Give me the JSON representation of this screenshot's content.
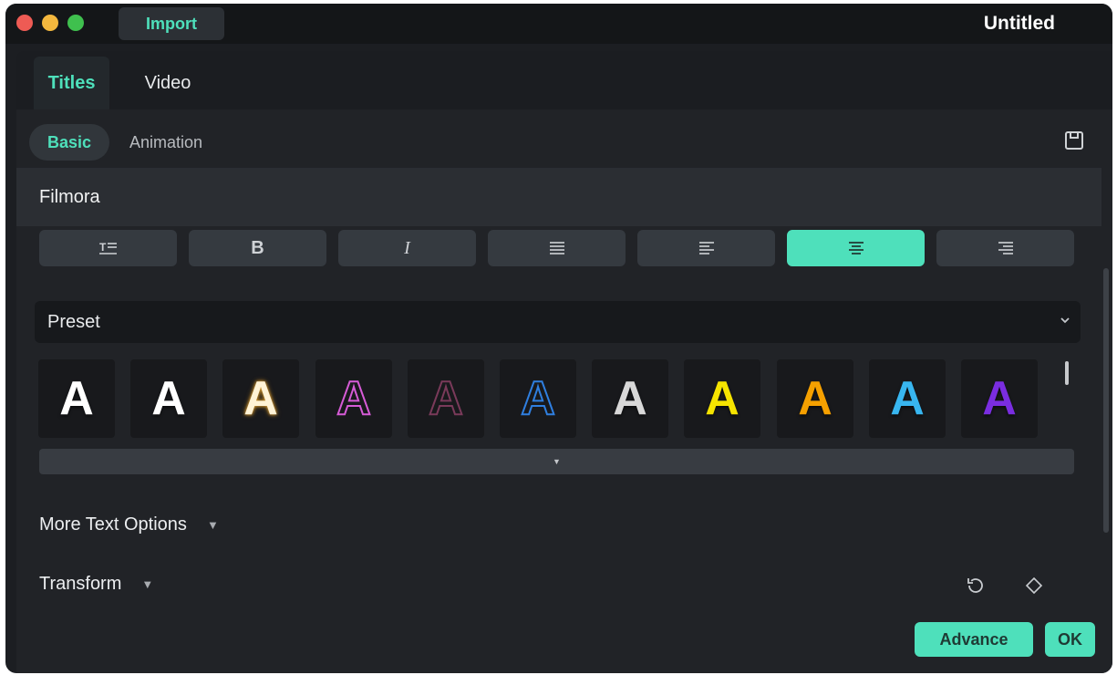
{
  "window": {
    "title": "Untitled",
    "import_label": "Import"
  },
  "tabs": [
    "Titles",
    "Video"
  ],
  "subtabs": [
    "Basic",
    "Animation"
  ],
  "text_input": {
    "value": "Filmora"
  },
  "format_buttons": [
    {
      "name": "text-size-icon",
      "glyph": "T≡"
    },
    {
      "name": "bold-button",
      "glyph": "B"
    },
    {
      "name": "italic-button",
      "glyph": "I"
    },
    {
      "name": "justify-icon",
      "glyph": "≣"
    },
    {
      "name": "align-left-icon",
      "glyph": "≡"
    },
    {
      "name": "align-center-icon",
      "glyph": "≣",
      "active": true
    },
    {
      "name": "align-right-icon",
      "glyph": "≡"
    }
  ],
  "preset": {
    "label": "Preset"
  },
  "presets": [
    {
      "letter": "A",
      "color": "#ffffff",
      "style": "solid"
    },
    {
      "letter": "A",
      "color": "#ffffff",
      "style": "solid"
    },
    {
      "letter": "A",
      "color": "#fff3d6",
      "style": "glow-gold"
    },
    {
      "letter": "A",
      "color": "#d65bd6",
      "style": "outline"
    },
    {
      "letter": "A",
      "color": "#7a3a5a",
      "style": "outline"
    },
    {
      "letter": "A",
      "color": "#2f7fe0",
      "style": "outline"
    },
    {
      "letter": "A",
      "color": "#d8d8d8",
      "style": "solid"
    },
    {
      "letter": "A",
      "color": "#f6e400",
      "style": "solid"
    },
    {
      "letter": "A",
      "color": "#f5a000",
      "style": "solid"
    },
    {
      "letter": "A",
      "color": "#38b6f0",
      "style": "solid"
    },
    {
      "letter": "A",
      "color": "#7a2de0",
      "style": "solid"
    }
  ],
  "sections": {
    "more_text_options": "More Text Options",
    "transform": "Transform"
  },
  "buttons": {
    "advance": "Advance",
    "ok": "OK"
  },
  "colors": {
    "accent": "#4ee0bb"
  }
}
